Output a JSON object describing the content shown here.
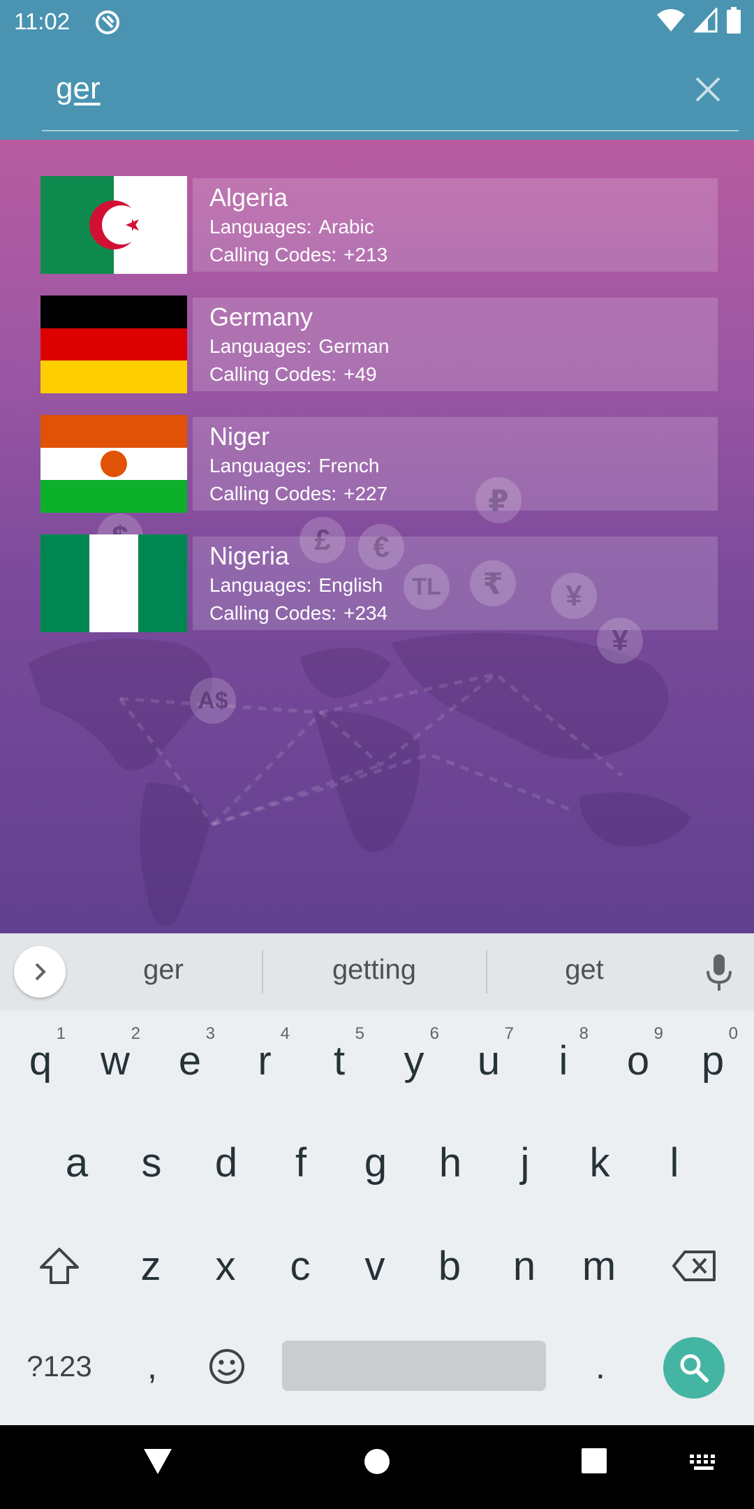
{
  "status_bar": {
    "time": "11:02",
    "icons": [
      "app-notification-icon",
      "wifi-icon",
      "cellular-signal-icon",
      "battery-icon"
    ]
  },
  "search": {
    "query": "ger",
    "clear_icon": "close-icon"
  },
  "countries": [
    {
      "name": "Algeria",
      "languages_label": "Languages:",
      "languages": "Arabic",
      "calling_label": "Calling Codes:",
      "calling_code": "+213",
      "flag": "algeria-flag-icon"
    },
    {
      "name": "Germany",
      "languages_label": "Languages:",
      "languages": "German",
      "calling_label": "Calling Codes:",
      "calling_code": "+49",
      "flag": "germany-flag-icon"
    },
    {
      "name": "Niger",
      "languages_label": "Languages:",
      "languages": "French",
      "calling_label": "Calling Codes:",
      "calling_code": "+227",
      "flag": "niger-flag-icon"
    },
    {
      "name": "Nigeria",
      "languages_label": "Languages:",
      "languages": "English",
      "calling_label": "Calling Codes:",
      "calling_code": "+234",
      "flag": "nigeria-flag-icon"
    }
  ],
  "background": {
    "currency_symbols": [
      "$",
      "£",
      "€",
      "₽",
      "TL",
      "₹",
      "¥",
      "¥",
      "A$"
    ]
  },
  "keyboard": {
    "suggestions": [
      "ger",
      "getting",
      "get"
    ],
    "row1": [
      "q",
      "w",
      "e",
      "r",
      "t",
      "y",
      "u",
      "i",
      "o",
      "p"
    ],
    "row1_hints": [
      "1",
      "2",
      "3",
      "4",
      "5",
      "6",
      "7",
      "8",
      "9",
      "0"
    ],
    "row2": [
      "a",
      "s",
      "d",
      "f",
      "g",
      "h",
      "j",
      "k",
      "l"
    ],
    "row3": [
      "z",
      "x",
      "c",
      "v",
      "b",
      "n",
      "m"
    ],
    "symbols_label": "?123",
    "comma": ",",
    "period": "."
  },
  "colors": {
    "header": "#4a94b2",
    "accent_search": "#45b5a3",
    "gradient_top": "#b85ca1",
    "gradient_bottom": "#61408f"
  }
}
